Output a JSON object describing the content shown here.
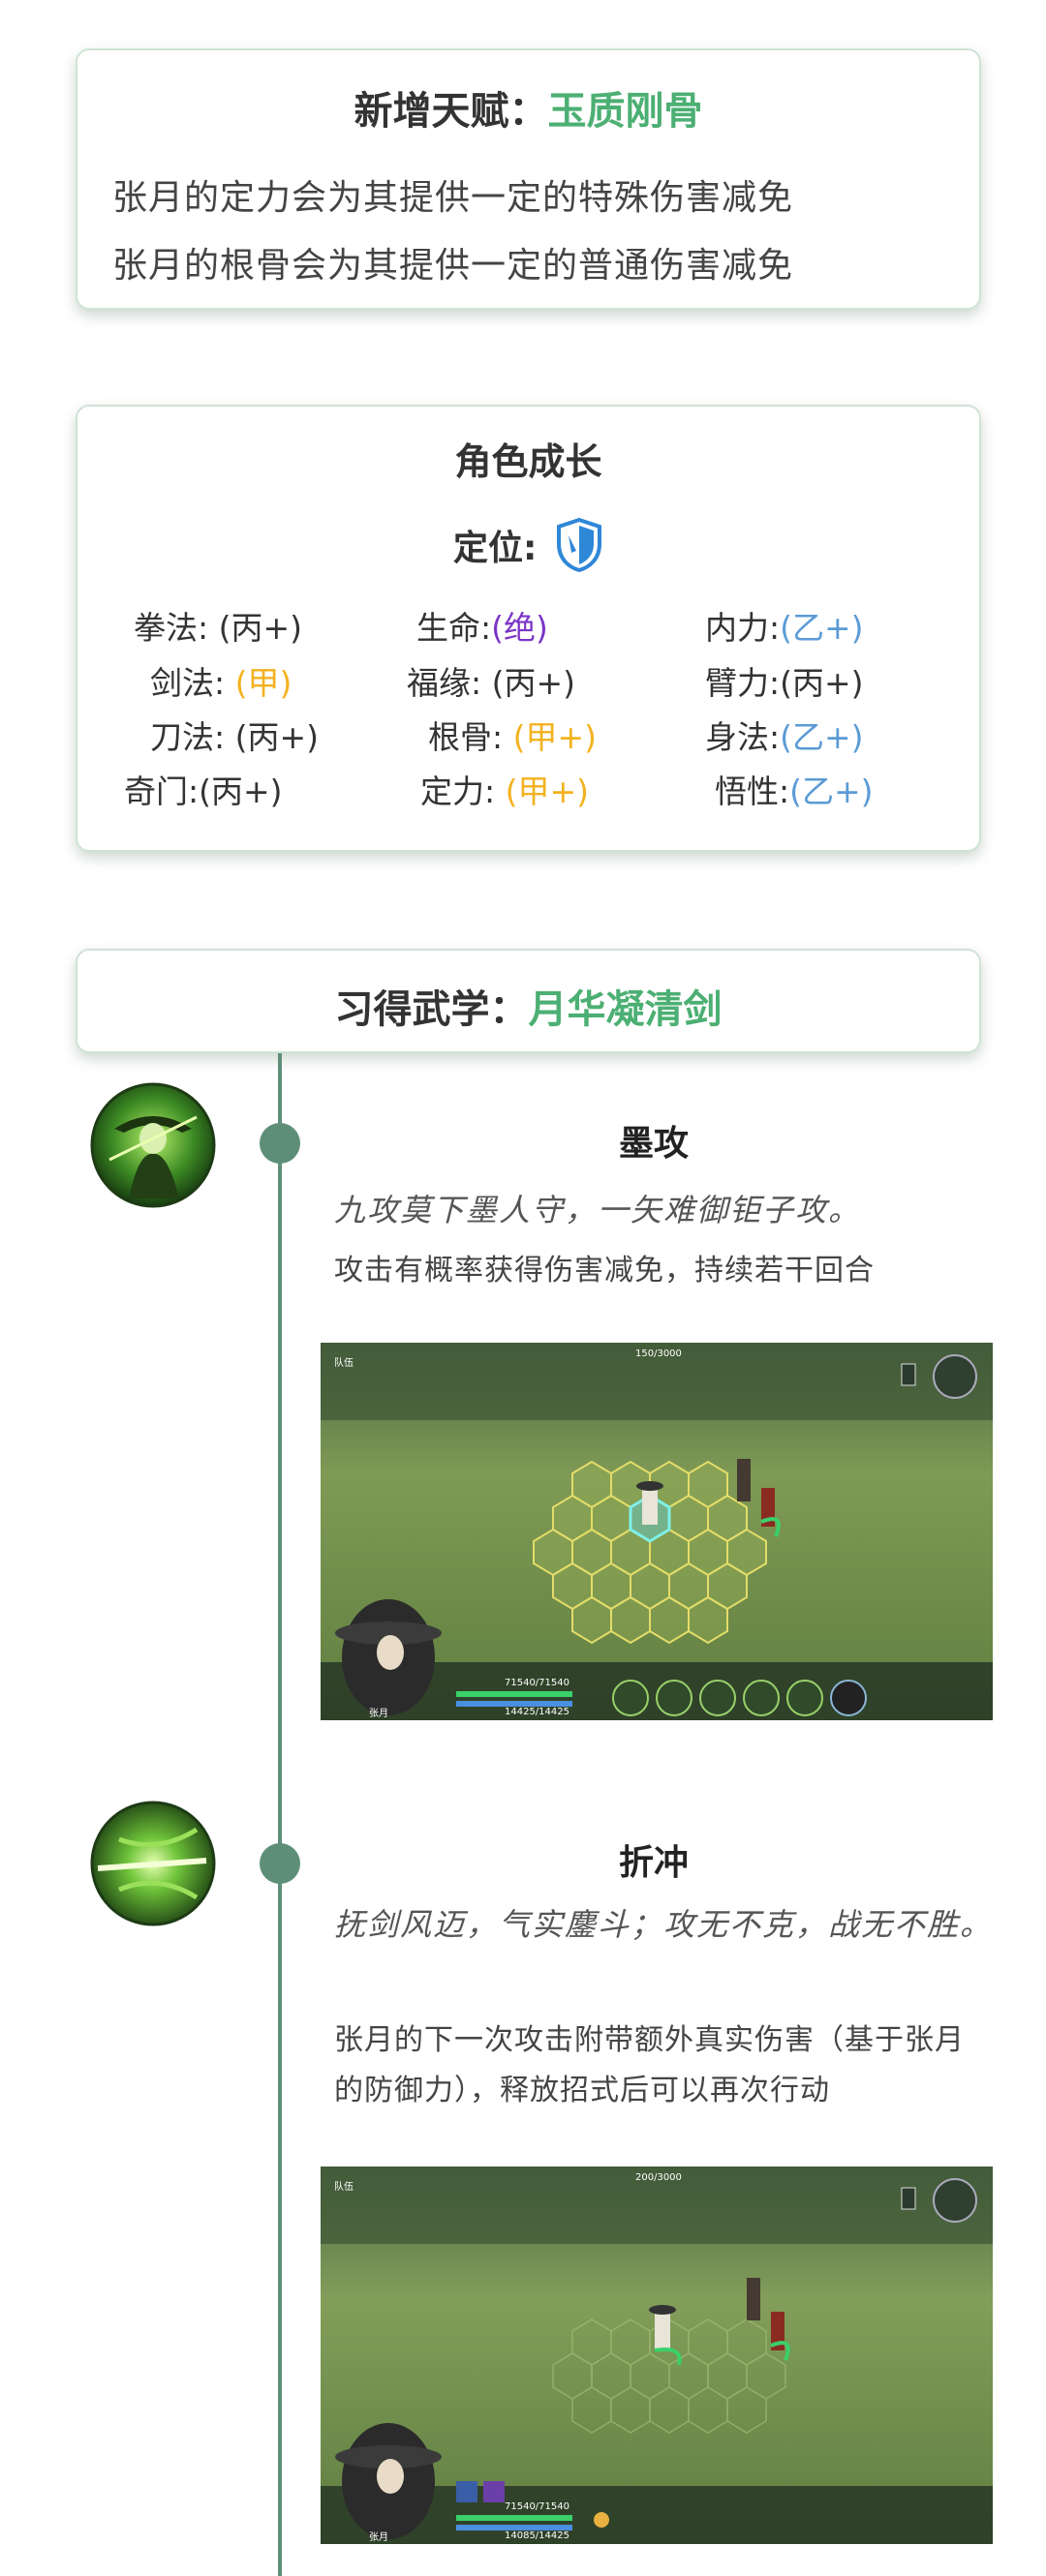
{
  "talent": {
    "prefix": "新增天赋：",
    "name": "玉质刚骨",
    "lines": [
      "张月的定力会为其提供一定的特殊伤害减免",
      "张月的根骨会为其提供一定的普通伤害减免"
    ]
  },
  "growth": {
    "title": "角色成长",
    "position_label": "定位:",
    "stats": [
      {
        "label": "拳法: ",
        "value": "(丙+)",
        "tone": "normal"
      },
      {
        "label": "生命:",
        "value": "(绝)",
        "tone": "jue"
      },
      {
        "label": "内力:",
        "value": "(乙+)",
        "tone": "yi"
      },
      {
        "label": "剑法: ",
        "value": "(甲)",
        "tone": "jia"
      },
      {
        "label": "福缘: ",
        "value": "(丙+)",
        "tone": "normal"
      },
      {
        "label": "臂力:",
        "value": "(丙+)",
        "tone": "normal"
      },
      {
        "label": "刀法: ",
        "value": "(丙+)",
        "tone": "normal"
      },
      {
        "label": "根骨: ",
        "value": "(甲+)",
        "tone": "jia"
      },
      {
        "label": "身法:",
        "value": "(乙+)",
        "tone": "yi"
      },
      {
        "label": "奇门:",
        "value": "(丙+)",
        "tone": "normal"
      },
      {
        "label": "定力: ",
        "value": "(甲+)",
        "tone": "jia"
      },
      {
        "label": "悟性:",
        "value": "(乙+)",
        "tone": "yi"
      }
    ]
  },
  "martial": {
    "prefix": "习得武学：",
    "name": "月华凝清剑"
  },
  "skills": [
    {
      "name": "墨攻",
      "poem": "九攻莫下墨人守，一矢难御钜子攻。",
      "desc": "攻击有概率获得伤害减免，持续若干回合",
      "hud": {
        "top_bar": "150/3000",
        "hp": "71540/71540",
        "mp": "14425/14425",
        "char": "张月",
        "menu": "队伍"
      }
    },
    {
      "name": "折冲",
      "poem": "抚剑风迈，气实鏖斗；攻无不克，战无不胜。",
      "desc": "张月的下一次攻击附带额外真实伤害（基于张月的防御力），释放招式后可以再次行动",
      "hud": {
        "top_bar": "200/3000",
        "hp": "71540/71540",
        "mp": "14085/14425",
        "char": "张月",
        "menu": "队伍"
      }
    }
  ],
  "colors": {
    "accent": "#4caf73",
    "timeline": "#5e8e78",
    "jia": "#f3b21e",
    "yi": "#5b9bd5",
    "jue": "#7a35c7"
  }
}
